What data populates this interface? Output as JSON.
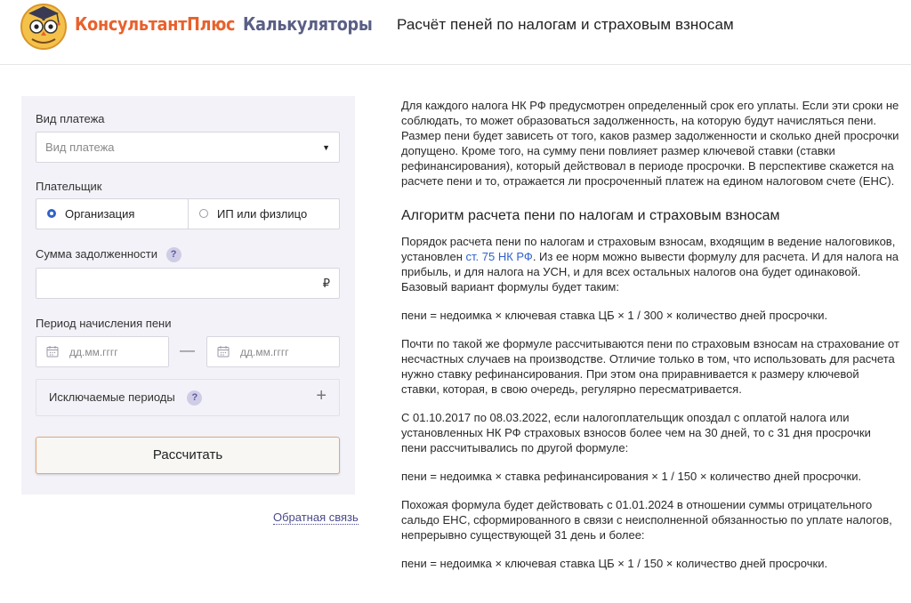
{
  "header": {
    "brand_main": "КонсультантПлюс",
    "brand_sub": "Калькуляторы",
    "page_title": "Расчёт пеней по налогам и страховым взносам"
  },
  "form": {
    "payment_type_label": "Вид платежа",
    "payment_type_placeholder": "Вид платежа",
    "payer_label": "Плательщик",
    "payer_option_org": "Организация",
    "payer_option_ip": "ИП или физлицо",
    "payer_selected": "Организация",
    "debt_label": "Сумма задолженности",
    "debt_currency": "₽",
    "period_label": "Период начисления пени",
    "date_from_placeholder": "дд.мм.гггг",
    "date_to_placeholder": "дд.мм.гггг",
    "date_separator": "—",
    "excluded_periods_label": "Исключаемые периоды",
    "help_symbol": "?",
    "add_symbol": "+",
    "calculate_button": "Рассчитать"
  },
  "feedback_link": "Обратная связь",
  "article": {
    "intro": "Для каждого налога НК РФ предусмотрен определенный срок его уплаты. Если эти сроки не соблюдать, то может образоваться задолженность, на которую будут начисляться пени. Размер пени будет зависеть от того, каков размер задолженности и сколько дней просрочки допущено. Кроме того, на сумму пени повлияет размер ключевой ставки (ставки рефинансирования), который действовал в периоде просрочки. В перспективе скажется на расчете пени и то, отражается ли просроченный платеж на едином налоговом счете (ЕНС).",
    "heading": "Алгоритм расчета пени по налогам и страховым взносам",
    "p1_before_link": "Порядок расчета пени по налогам и страховым взносам, входящим в ведение налоговиков, установлен ",
    "p1_link": "ст. 75 НК РФ",
    "p1_after_link": ". Из ее норм можно вывести формулу для расчета. И для налога на прибыль, и для налога на УСН, и для всех остальных налогов она будет одинаковой. Базовый вариант формулы будет таким:",
    "formula1": "пени = недоимка × ключевая ставка ЦБ × 1 / 300 × количество дней просрочки.",
    "p2": "Почти по такой же формуле рассчитываются пени по страховым взносам на страхование от несчастных случаев на производстве. Отличие только в том, что использовать для расчета нужно ставку рефинансирования. При этом она приравнивается к размеру ключевой ставки, которая, в свою очередь, регулярно пересматривается.",
    "p3": "С 01.10.2017 по 08.03.2022, если налогоплательщик опоздал с оплатой налога или установленных НК РФ страховых взносов более чем на 30 дней, то с 31 дня просрочки пени рассчитывались по другой формуле:",
    "formula2": "пени = недоимка × ставка рефинансирования × 1 / 150 × количество дней просрочки.",
    "p4": "Похожая формула будет действовать с 01.01.2024 в отношении суммы отрицательного сальдо ЕНС, сформированного в связи с неисполненной обязанностью по уплате налогов, непрерывно существующей 31 день и более:",
    "formula3": "пени = недоимка × ключевая ставка ЦБ × 1 / 150 × количество дней просрочки."
  },
  "colors": {
    "brand_orange": "#e8612c",
    "brand_purple": "#5a5f86",
    "panel_bg": "#f3f2f8",
    "link_blue": "#2f62c9",
    "button_border": "#e1a978"
  }
}
